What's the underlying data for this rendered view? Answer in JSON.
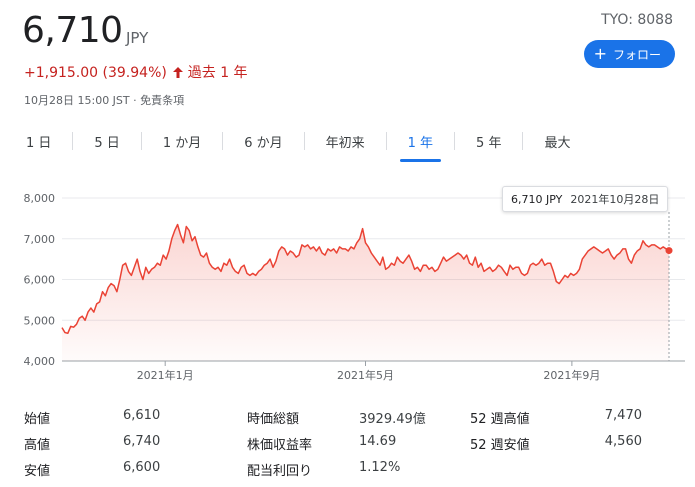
{
  "header": {
    "price": "6,710",
    "currency": "JPY",
    "change": "+1,915.00 (39.94%)",
    "change_period": "過去 1 年",
    "timestamp": "10月28日 15:00 JST · 免責条項",
    "ticker": "TYO: 8088",
    "follow_label": "フォロー"
  },
  "tabs": [
    {
      "label": "1 日",
      "active": false
    },
    {
      "label": "5 日",
      "active": false
    },
    {
      "label": "1 か月",
      "active": false
    },
    {
      "label": "6 か月",
      "active": false
    },
    {
      "label": "年初来",
      "active": false
    },
    {
      "label": "1 年",
      "active": true
    },
    {
      "label": "5 年",
      "active": false
    },
    {
      "label": "最大",
      "active": false
    }
  ],
  "tooltip": {
    "value": "6,710 JPY",
    "date": "2021年10月28日"
  },
  "colors": {
    "line": "#ea4335",
    "accent": "#1a73e8",
    "change": "#c5221f"
  },
  "chart_data": {
    "type": "line",
    "y_ticks": [
      "8,000",
      "7,000",
      "6,000",
      "5,000",
      "4,000"
    ],
    "ylim": [
      4000,
      8000
    ],
    "x_ticks": [
      "2021年1月",
      "2021年5月",
      "2021年9月"
    ],
    "series": [
      {
        "values": [
          4820,
          4700,
          4680,
          4850,
          4830,
          4900,
          5050,
          5100,
          5000,
          5200,
          5300,
          5200,
          5400,
          5450,
          5700,
          5600,
          5800,
          5900,
          5850,
          5700,
          6000,
          6350,
          6400,
          6200,
          6100,
          6300,
          6500,
          6200,
          6000,
          6300,
          6150,
          6250,
          6300,
          6400,
          6350,
          6600,
          6500,
          6700,
          7000,
          7200,
          7350,
          7100,
          6900,
          7300,
          7200,
          6950,
          7050,
          6800,
          6600,
          6550,
          6650,
          6400,
          6300,
          6250,
          6300,
          6200,
          6400,
          6350,
          6500,
          6300,
          6200,
          6150,
          6300,
          6350,
          6150,
          6100,
          6150,
          6100,
          6200,
          6250,
          6350,
          6400,
          6500,
          6300,
          6450,
          6700,
          6800,
          6750,
          6600,
          6700,
          6650,
          6550,
          6600,
          6850,
          6800,
          6850,
          6750,
          6800,
          6700,
          6800,
          6650,
          6600,
          6750,
          6700,
          6750,
          6650,
          6800,
          6750,
          6750,
          6700,
          6800,
          6750,
          6900,
          7000,
          7250,
          6900,
          6800,
          6650,
          6550,
          6450,
          6350,
          6550,
          6250,
          6300,
          6400,
          6350,
          6550,
          6450,
          6400,
          6500,
          6600,
          6450,
          6250,
          6300,
          6200,
          6350,
          6350,
          6250,
          6300,
          6200,
          6250,
          6400,
          6550,
          6450,
          6500,
          6550,
          6600,
          6650,
          6600,
          6500,
          6600,
          6400,
          6350,
          6550,
          6300,
          6400,
          6200,
          6250,
          6300,
          6200,
          6250,
          6350,
          6300,
          6200,
          6100,
          6350,
          6250,
          6300,
          6300,
          6150,
          6100,
          6150,
          6350,
          6400,
          6350,
          6400,
          6500,
          6350,
          6400,
          6400,
          6200,
          5950,
          5900,
          6000,
          6100,
          6050,
          6150,
          6100,
          6150,
          6250,
          6500,
          6600,
          6700,
          6750,
          6800,
          6750,
          6700,
          6650,
          6700,
          6750,
          6600,
          6500,
          6600,
          6650,
          6750,
          6750,
          6500,
          6400,
          6600,
          6700,
          6750,
          6950,
          6850,
          6800,
          6850,
          6850,
          6800,
          6750,
          6800,
          6750,
          6710
        ]
      }
    ]
  },
  "stats": [
    [
      {
        "label": "始値",
        "value": "6,610"
      },
      {
        "label": "時価総額",
        "value": "3929.49億"
      },
      {
        "label": "52 週高値",
        "value": "7,470"
      }
    ],
    [
      {
        "label": "高値",
        "value": "6,740"
      },
      {
        "label": "株価収益率",
        "value": "14.69"
      },
      {
        "label": "52 週安値",
        "value": "4,560"
      }
    ],
    [
      {
        "label": "安値",
        "value": "6,600"
      },
      {
        "label": "配当利回り",
        "value": "1.12%"
      },
      {
        "label": "",
        "value": ""
      }
    ]
  ]
}
